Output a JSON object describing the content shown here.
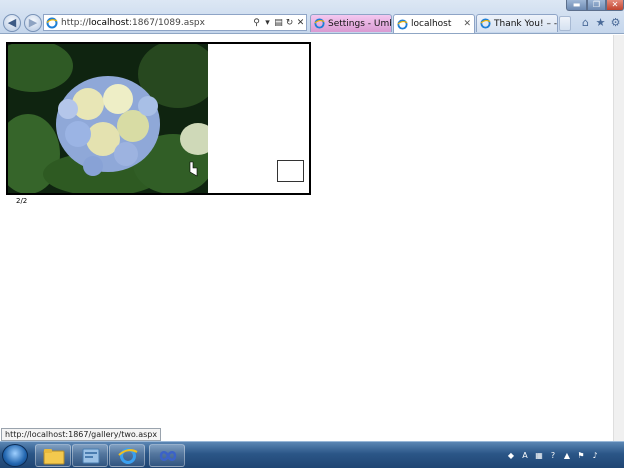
{
  "window": {
    "minimize_glyph": "▬",
    "maximize_glyph": "❐",
    "close_glyph": "✕"
  },
  "nav": {
    "back_glyph": "◀",
    "forward_glyph": "▶"
  },
  "address_bar": {
    "url_prefix": "http://",
    "url_host": "localhost",
    "url_rest": ":1867/1089.aspx",
    "search_glyph": "⚲",
    "dropdown_glyph": "▾",
    "compat_glyph": "▤",
    "refresh_glyph": "↻",
    "stop_glyph": "✕"
  },
  "tabs": [
    {
      "label": "Settings - Umbra...",
      "state": "inactive"
    },
    {
      "label": "localhost",
      "state": "active",
      "close_glyph": "✕"
    },
    {
      "label": "Thank You! – -Pik...",
      "state": "inactive"
    }
  ],
  "toolbar": {
    "home_glyph": "⌂",
    "favorites_glyph": "★",
    "tools_glyph": "⚙"
  },
  "content": {
    "image_subject": "blue and cream hydrangea flower with green leaves",
    "page_counter": "2/2"
  },
  "status_bar": {
    "link_url": "http://localhost:1867/gallery/two.aspx"
  },
  "taskbar": {
    "pinned": [
      "windows-explorer",
      "visual-studio",
      "internet-explorer",
      "app-infinity"
    ],
    "tray_icons": [
      "network",
      "language-a",
      "keyboard",
      "help",
      "arrow-up",
      "flag",
      "speaker"
    ]
  },
  "colors": {
    "chrome_bg": "#c5d6ec",
    "settings_tab": "#d99ad2",
    "taskbar": "#2b5687",
    "frame_border": "#000000"
  }
}
